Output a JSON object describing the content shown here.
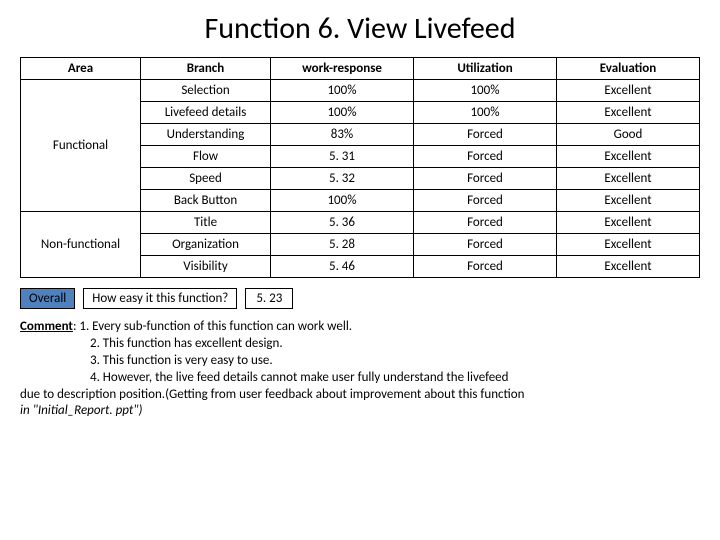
{
  "title": "Function 6. View Livefeed",
  "headers": [
    "Area",
    "Branch",
    "work-response",
    "Utilization",
    "Evaluation"
  ],
  "groups": [
    {
      "area": "Functional",
      "rows": [
        {
          "branch": "Selection",
          "wr": "100%",
          "util": "100%",
          "eval": "Excellent"
        },
        {
          "branch": "Livefeed details",
          "wr": "100%",
          "util": "100%",
          "eval": "Excellent"
        },
        {
          "branch": "Understanding",
          "wr": "83%",
          "util": "Forced",
          "eval": "Good"
        },
        {
          "branch": "Flow",
          "wr": "5. 31",
          "util": "Forced",
          "eval": "Excellent"
        },
        {
          "branch": "Speed",
          "wr": "5. 32",
          "util": "Forced",
          "eval": "Excellent"
        },
        {
          "branch": "Back Button",
          "wr": "100%",
          "util": "Forced",
          "eval": "Excellent"
        }
      ]
    },
    {
      "area": "Non-functional",
      "rows": [
        {
          "branch": "Title",
          "wr": "5. 36",
          "util": "Forced",
          "eval": "Excellent"
        },
        {
          "branch": "Organization",
          "wr": "5. 28",
          "util": "Forced",
          "eval": "Excellent"
        },
        {
          "branch": "Visibility",
          "wr": "5. 46",
          "util": "Forced",
          "eval": "Excellent"
        }
      ]
    }
  ],
  "overall": {
    "label": "Overall",
    "question": "How easy it this function?",
    "value": "5. 23"
  },
  "comment": {
    "label": "Comment",
    "lines": [
      "1. Every sub-function of this function can work well.",
      "2. This function has excellent design.",
      "3. This function is very easy to use.",
      "4. However, the live feed details cannot make user fully understand the livefeed"
    ],
    "tail1": "due to description position.(Getting from  user feedback about improvement about this function",
    "tail2": "in \"Initial_Report. ppt\")"
  },
  "chart_data": {
    "type": "table",
    "title": "Function 6. View Livefeed",
    "columns": [
      "Area",
      "Branch",
      "work-response",
      "Utilization",
      "Evaluation"
    ],
    "rows": [
      [
        "Functional",
        "Selection",
        "100%",
        "100%",
        "Excellent"
      ],
      [
        "Functional",
        "Livefeed details",
        "100%",
        "100%",
        "Excellent"
      ],
      [
        "Functional",
        "Understanding",
        "83%",
        "Forced",
        "Good"
      ],
      [
        "Functional",
        "Flow",
        "5. 31",
        "Forced",
        "Excellent"
      ],
      [
        "Functional",
        "Speed",
        "5. 32",
        "Forced",
        "Excellent"
      ],
      [
        "Functional",
        "Back Button",
        "100%",
        "Forced",
        "Excellent"
      ],
      [
        "Non-functional",
        "Title",
        "5. 36",
        "Forced",
        "Excellent"
      ],
      [
        "Non-functional",
        "Organization",
        "5. 28",
        "Forced",
        "Excellent"
      ],
      [
        "Non-functional",
        "Visibility",
        "5. 46",
        "Forced",
        "Excellent"
      ]
    ],
    "overall": {
      "question": "How easy it this function?",
      "value": "5. 23"
    }
  }
}
